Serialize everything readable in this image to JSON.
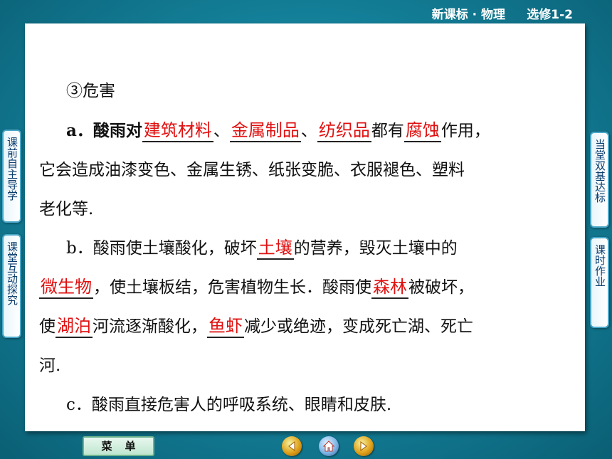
{
  "header": {
    "course": "新课标 · 物理",
    "volume": "选修1-2"
  },
  "sidebar_left": [
    {
      "label": "课前自主导学"
    },
    {
      "label": "课堂互动探究"
    }
  ],
  "sidebar_right": [
    {
      "label": "当堂双基达标"
    },
    {
      "label": "课时作业"
    }
  ],
  "content": {
    "heading": "③危害",
    "para_a": {
      "prefix": "a．酸雨对",
      "ans1": "建筑材料",
      "sep1": "、",
      "ans2": "金属制品",
      "sep2": "、",
      "ans3": "纺织品",
      "mid": "都有",
      "ans4": "腐蚀",
      "suffix": "作用，",
      "line2": "它会造成油漆变色、金属生锈、纸张变脆、衣服褪色、塑料",
      "line3": "老化等."
    },
    "para_b": {
      "prefix": "b．酸雨使土壤酸化，破坏",
      "ans1": "土壤",
      "after1": "的营养，毁灭土壤中的",
      "ans2": "微生物",
      "after2": "，使土壤板结，危害植物生长．酸雨使",
      "ans3": "森林",
      "after3": "被破坏，",
      "pre4": "使",
      "ans4": "湖泊",
      "after4": "河流逐渐酸化，",
      "ans5": "鱼虾",
      "after5": "减少或绝迹，变成死亡湖、死亡",
      "line_end": "河."
    },
    "para_c": "c．酸雨直接危害人的呼吸系统、眼睛和皮肤."
  },
  "footer": {
    "menu_label": "菜单"
  },
  "colors": {
    "answer": "#e01010",
    "background": "#137e97"
  }
}
